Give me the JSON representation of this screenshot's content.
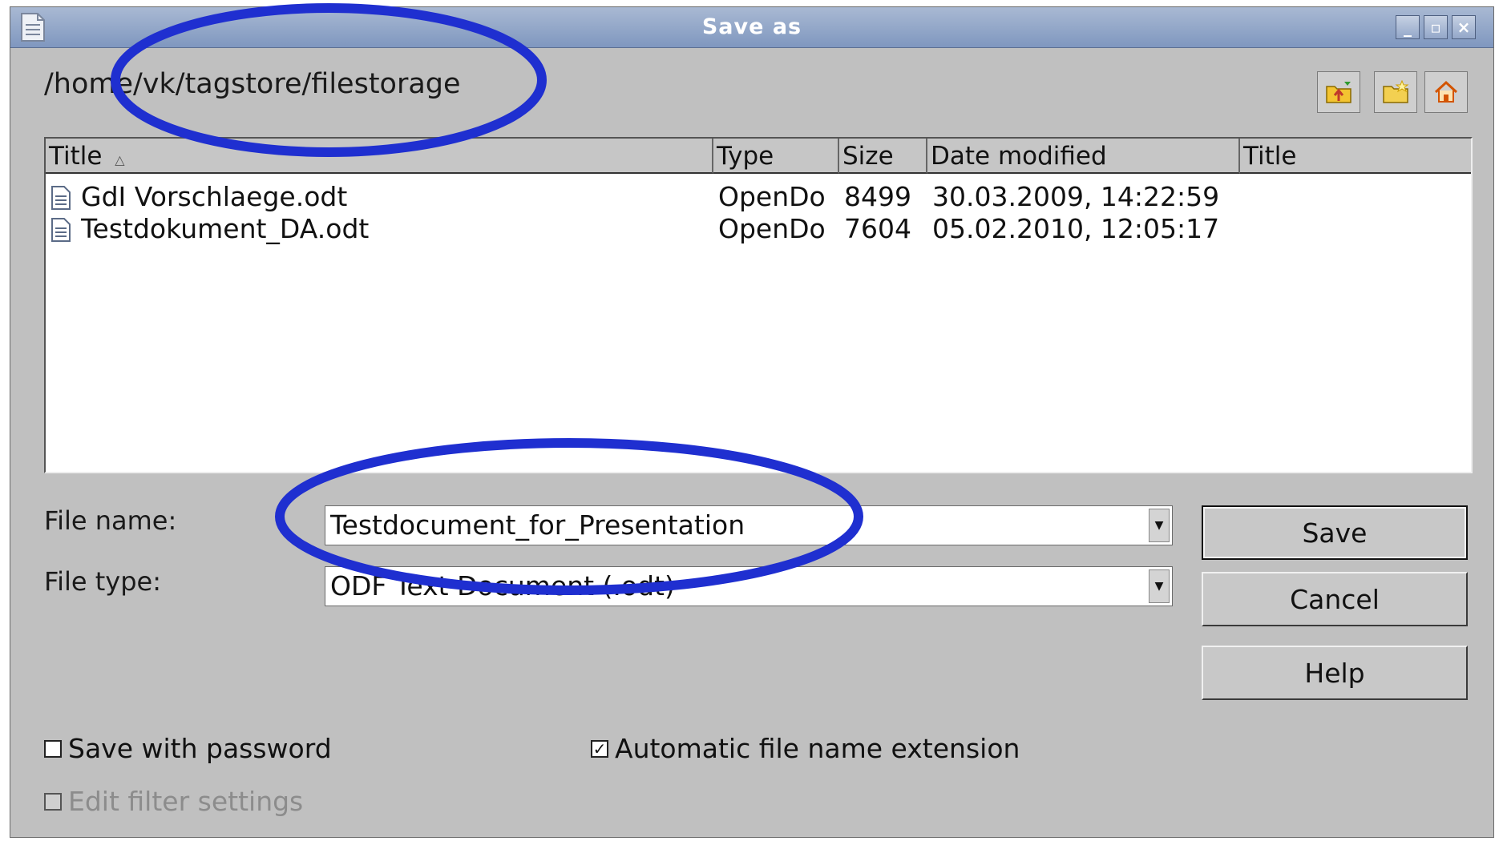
{
  "window": {
    "title": "Save as",
    "minimize_icon": "minimize-icon",
    "maximize_icon": "maximize-icon",
    "close_icon": "close-icon"
  },
  "path": "/home/vk/tagstore/filestorage",
  "toolbar": [
    "up-one-level-icon",
    "create-new-folder-icon",
    "default-directory-icon"
  ],
  "filelist": {
    "columns": [
      "Title",
      "Type",
      "Size",
      "Date modified",
      "Title"
    ],
    "sort_indicator": "△",
    "rows": [
      {
        "name": "GdI Vorschlaege.odt",
        "type": "OpenDo",
        "size": "8499",
        "modified": "30.03.2009, 14:22:59"
      },
      {
        "name": "Testdokument_DA.odt",
        "type": "OpenDo",
        "size": "7604",
        "modified": "05.02.2010, 12:05:17"
      }
    ]
  },
  "file_name": {
    "label": "File name:",
    "value": "Testdocument_for_Presentation"
  },
  "file_type": {
    "label": "File type:",
    "value": "ODF Text Document (.odt)"
  },
  "buttons": {
    "save": "Save",
    "cancel": "Cancel",
    "help": "Help"
  },
  "options": {
    "password": {
      "label": "Save with password",
      "checked": false
    },
    "extension": {
      "label": "Automatic file name extension",
      "checked": true
    },
    "filter": {
      "label": "Edit filter settings",
      "checked": false,
      "enabled": false
    }
  },
  "colors": {
    "annotation": "#1f2fd0",
    "titlebar": "#8ea3c8",
    "dialog": "#c0c0c0"
  }
}
